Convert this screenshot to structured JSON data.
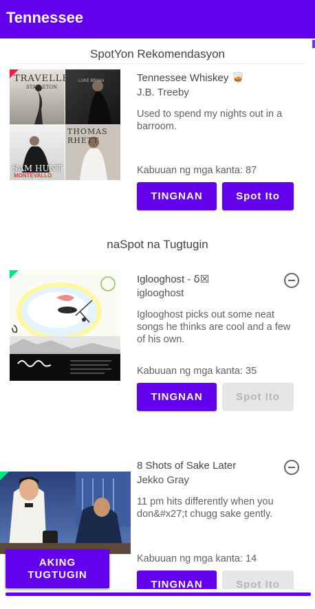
{
  "app": {
    "title": "Tennessee"
  },
  "recommendation": {
    "section_title": "SpotYon Rekomendasyon",
    "card": {
      "title": "Tennessee Whiskey 🥃",
      "artist": "J.B. Treeby",
      "description": "Used to spend my nights out in a barroom.",
      "count": "Kabuuan ng mga kanta: 87",
      "view_button": "TINGNAN",
      "spot_button": "Spot Ito",
      "art_texts": {
        "traveller": "TRAVELLER",
        "stapleton": "STAPLETON",
        "luke": "LUKE BRYAN",
        "thomas": "THOMAS RHETT",
        "sam": "SAM HUNT",
        "montevallo": "MONTEVALLO"
      }
    }
  },
  "spotted": {
    "section_title": "naSpot na Tugtugin",
    "cards": [
      {
        "title": "Iglooghost - ẟ☒",
        "artist": "iglooghost",
        "description": "Iglooghost picks out some neat songs he thinks are cool and a few of his own.",
        "count": "Kabuuan ng mga kanta: 35",
        "view_button": "TINGNAN",
        "spot_button": "Spot Ito"
      },
      {
        "title": "8 Shots of Sake Later",
        "artist": "Jekko Gray",
        "description": "11 pm hits differently when you don&#x27;t chugg sake gently.",
        "count": "Kabuuan ng mga kanta: 14",
        "view_button": "TINGNAN",
        "spot_button": "Spot Ito"
      }
    ]
  },
  "fab": {
    "label": "AKING TUGTUGIN"
  },
  "colors": {
    "primary": "#6200ee",
    "recommend_corner": "#ff1744",
    "spotted_corner": "#00e676"
  },
  "icons": {
    "remove": "remove-circle-outline-icon"
  }
}
